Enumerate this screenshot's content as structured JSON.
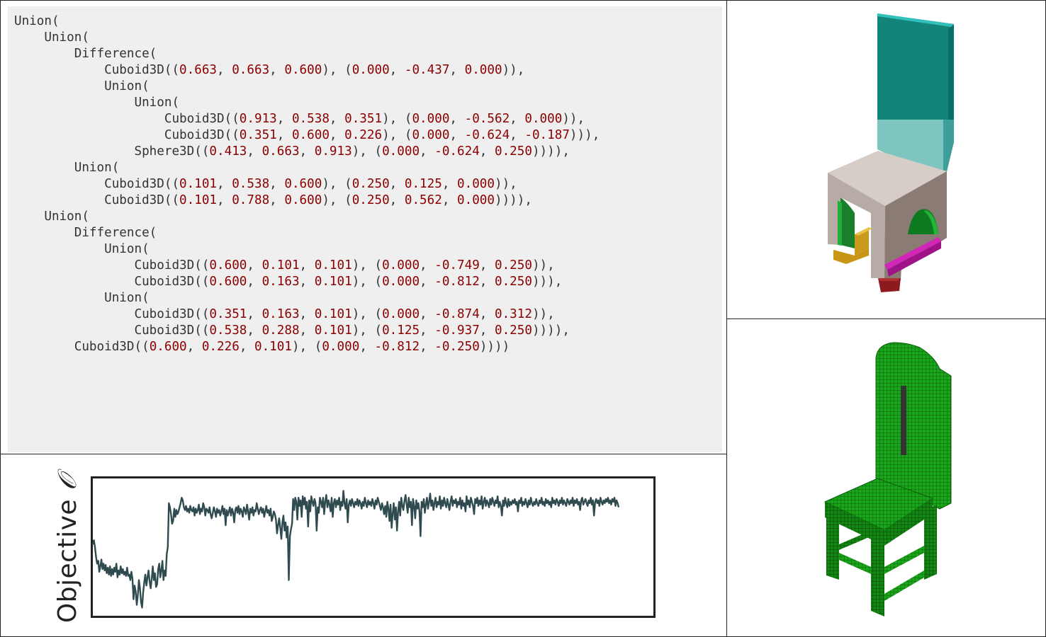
{
  "code": {
    "lines": [
      {
        "indent": 0,
        "parts": [
          {
            "t": "Union("
          }
        ]
      },
      {
        "indent": 1,
        "parts": [
          {
            "t": "Union("
          }
        ]
      },
      {
        "indent": 2,
        "parts": [
          {
            "t": "Difference("
          }
        ]
      },
      {
        "indent": 3,
        "parts": [
          {
            "t": "Cuboid3D(("
          },
          {
            "n": "0.663"
          },
          {
            "t": ", "
          },
          {
            "n": "0.663"
          },
          {
            "t": ", "
          },
          {
            "n": "0.600"
          },
          {
            "t": "), ("
          },
          {
            "n": "0.000"
          },
          {
            "t": ", "
          },
          {
            "n": "-0.437"
          },
          {
            "t": ", "
          },
          {
            "n": "0.000"
          },
          {
            "t": ")),"
          }
        ]
      },
      {
        "indent": 3,
        "parts": [
          {
            "t": "Union("
          }
        ]
      },
      {
        "indent": 4,
        "parts": [
          {
            "t": "Union("
          }
        ]
      },
      {
        "indent": 5,
        "parts": [
          {
            "t": "Cuboid3D(("
          },
          {
            "n": "0.913"
          },
          {
            "t": ", "
          },
          {
            "n": "0.538"
          },
          {
            "t": ", "
          },
          {
            "n": "0.351"
          },
          {
            "t": "), ("
          },
          {
            "n": "0.000"
          },
          {
            "t": ", "
          },
          {
            "n": "-0.562"
          },
          {
            "t": ", "
          },
          {
            "n": "0.000"
          },
          {
            "t": ")),"
          }
        ]
      },
      {
        "indent": 5,
        "parts": [
          {
            "t": "Cuboid3D(("
          },
          {
            "n": "0.351"
          },
          {
            "t": ", "
          },
          {
            "n": "0.600"
          },
          {
            "t": ", "
          },
          {
            "n": "0.226"
          },
          {
            "t": "), ("
          },
          {
            "n": "0.000"
          },
          {
            "t": ", "
          },
          {
            "n": "-0.624"
          },
          {
            "t": ", "
          },
          {
            "n": "-0.187"
          },
          {
            "t": "))),"
          }
        ]
      },
      {
        "indent": 4,
        "parts": [
          {
            "t": "Sphere3D(("
          },
          {
            "n": "0.413"
          },
          {
            "t": ", "
          },
          {
            "n": "0.663"
          },
          {
            "t": ", "
          },
          {
            "n": "0.913"
          },
          {
            "t": "), ("
          },
          {
            "n": "0.000"
          },
          {
            "t": ", "
          },
          {
            "n": "-0.624"
          },
          {
            "t": ", "
          },
          {
            "n": "0.250"
          },
          {
            "t": ")))),"
          }
        ]
      },
      {
        "indent": 2,
        "parts": [
          {
            "t": "Union("
          }
        ]
      },
      {
        "indent": 3,
        "parts": [
          {
            "t": "Cuboid3D(("
          },
          {
            "n": "0.101"
          },
          {
            "t": ", "
          },
          {
            "n": "0.538"
          },
          {
            "t": ", "
          },
          {
            "n": "0.600"
          },
          {
            "t": "), ("
          },
          {
            "n": "0.250"
          },
          {
            "t": ", "
          },
          {
            "n": "0.125"
          },
          {
            "t": ", "
          },
          {
            "n": "0.000"
          },
          {
            "t": ")),"
          }
        ]
      },
      {
        "indent": 3,
        "parts": [
          {
            "t": "Cuboid3D(("
          },
          {
            "n": "0.101"
          },
          {
            "t": ", "
          },
          {
            "n": "0.788"
          },
          {
            "t": ", "
          },
          {
            "n": "0.600"
          },
          {
            "t": "), ("
          },
          {
            "n": "0.250"
          },
          {
            "t": ", "
          },
          {
            "n": "0.562"
          },
          {
            "t": ", "
          },
          {
            "n": "0.000"
          },
          {
            "t": ")))),"
          }
        ]
      },
      {
        "indent": 1,
        "parts": [
          {
            "t": "Union("
          }
        ]
      },
      {
        "indent": 2,
        "parts": [
          {
            "t": "Difference("
          }
        ]
      },
      {
        "indent": 3,
        "parts": [
          {
            "t": "Union("
          }
        ]
      },
      {
        "indent": 4,
        "parts": [
          {
            "t": "Cuboid3D(("
          },
          {
            "n": "0.600"
          },
          {
            "t": ", "
          },
          {
            "n": "0.101"
          },
          {
            "t": ", "
          },
          {
            "n": "0.101"
          },
          {
            "t": "), ("
          },
          {
            "n": "0.000"
          },
          {
            "t": ", "
          },
          {
            "n": "-0.749"
          },
          {
            "t": ", "
          },
          {
            "n": "0.250"
          },
          {
            "t": ")),"
          }
        ]
      },
      {
        "indent": 4,
        "parts": [
          {
            "t": "Cuboid3D(("
          },
          {
            "n": "0.600"
          },
          {
            "t": ", "
          },
          {
            "n": "0.163"
          },
          {
            "t": ", "
          },
          {
            "n": "0.101"
          },
          {
            "t": "), ("
          },
          {
            "n": "0.000"
          },
          {
            "t": ", "
          },
          {
            "n": "-0.812"
          },
          {
            "t": ", "
          },
          {
            "n": "0.250"
          },
          {
            "t": "))),"
          }
        ]
      },
      {
        "indent": 3,
        "parts": [
          {
            "t": "Union("
          }
        ]
      },
      {
        "indent": 4,
        "parts": [
          {
            "t": "Cuboid3D(("
          },
          {
            "n": "0.351"
          },
          {
            "t": ", "
          },
          {
            "n": "0.163"
          },
          {
            "t": ", "
          },
          {
            "n": "0.101"
          },
          {
            "t": "), ("
          },
          {
            "n": "0.000"
          },
          {
            "t": ", "
          },
          {
            "n": "-0.874"
          },
          {
            "t": ", "
          },
          {
            "n": "0.312"
          },
          {
            "t": ")),"
          }
        ]
      },
      {
        "indent": 4,
        "parts": [
          {
            "t": "Cuboid3D(("
          },
          {
            "n": "0.538"
          },
          {
            "t": ", "
          },
          {
            "n": "0.288"
          },
          {
            "t": ", "
          },
          {
            "n": "0.101"
          },
          {
            "t": "), ("
          },
          {
            "n": "0.125"
          },
          {
            "t": ", "
          },
          {
            "n": "-0.937"
          },
          {
            "t": ", "
          },
          {
            "n": "0.250"
          },
          {
            "t": ")))),"
          }
        ]
      },
      {
        "indent": 2,
        "parts": [
          {
            "t": "Cuboid3D(("
          },
          {
            "n": "0.600"
          },
          {
            "t": ", "
          },
          {
            "n": "0.226"
          },
          {
            "t": ", "
          },
          {
            "n": "0.101"
          },
          {
            "t": "), ("
          },
          {
            "n": "0.000"
          },
          {
            "t": ", "
          },
          {
            "n": "-0.812"
          },
          {
            "t": ", "
          },
          {
            "n": "-0.250"
          },
          {
            "t": "))))"
          }
        ]
      }
    ]
  },
  "plot": {
    "ylabel": "Objective",
    "ylabel_symbol": "𝒪"
  },
  "colors": {
    "code_background": "#efefef",
    "code_text": "#333333",
    "code_number": "#8b0000",
    "plot_line": "#2f4b4f",
    "teal_back": "#18958a",
    "seat": "#d6cdc6",
    "voxel_green": "#1aa51a"
  },
  "chart_data": {
    "type": "line",
    "title": "",
    "xlabel": "",
    "ylabel": "Objective 𝒪",
    "grid": false,
    "ylim": [
      0,
      1
    ],
    "series": [
      {
        "values": [
          0.52,
          0.55,
          0.5,
          0.43,
          0.38,
          0.4,
          0.32,
          0.36,
          0.41,
          0.34,
          0.38,
          0.33,
          0.37,
          0.31,
          0.35,
          0.3,
          0.36,
          0.29,
          0.34,
          0.3,
          0.35,
          0.32,
          0.38,
          0.28,
          0.33,
          0.3,
          0.36,
          0.31,
          0.34,
          0.3,
          0.32,
          0.29,
          0.35,
          0.29,
          0.3,
          0.26,
          0.32,
          0.27,
          0.12,
          0.22,
          0.18,
          0.08,
          0.15,
          0.26,
          0.2,
          0.1,
          0.06,
          0.17,
          0.24,
          0.3,
          0.22,
          0.28,
          0.33,
          0.25,
          0.2,
          0.27,
          0.36,
          0.26,
          0.31,
          0.21,
          0.23,
          0.34,
          0.38,
          0.28,
          0.33,
          0.4,
          0.26,
          0.33,
          0.29,
          0.45,
          0.5,
          0.82,
          0.79,
          0.74,
          0.67,
          0.69,
          0.78,
          0.72,
          0.77,
          0.74,
          0.76,
          0.79,
          0.82,
          0.86,
          0.84,
          0.79,
          0.77,
          0.8,
          0.76,
          0.78,
          0.75,
          0.8,
          0.77,
          0.76,
          0.79,
          0.73,
          0.78,
          0.75,
          0.77,
          0.81,
          0.74,
          0.78,
          0.76,
          0.82,
          0.79,
          0.73,
          0.78,
          0.77,
          0.75,
          0.79,
          0.74,
          0.71,
          0.75,
          0.79,
          0.76,
          0.72,
          0.78,
          0.75,
          0.77,
          0.73,
          0.76,
          0.8,
          0.74,
          0.78,
          0.66,
          0.77,
          0.73,
          0.76,
          0.79,
          0.73,
          0.78,
          0.75,
          0.68,
          0.77,
          0.79,
          0.75,
          0.8,
          0.74,
          0.78,
          0.76,
          0.72,
          0.79,
          0.77,
          0.74,
          0.81,
          0.76,
          0.7,
          0.78,
          0.75,
          0.79,
          0.73,
          0.77,
          0.76,
          0.82,
          0.78,
          0.74,
          0.77,
          0.79,
          0.75,
          0.78,
          0.72,
          0.76,
          0.8,
          0.75,
          0.77,
          0.73,
          0.78,
          0.69,
          0.72,
          0.76,
          0.74,
          0.7,
          0.6,
          0.66,
          0.71,
          0.64,
          0.56,
          0.68,
          0.73,
          0.62,
          0.68,
          0.57,
          0.65,
          0.26,
          0.58,
          0.63,
          0.67,
          0.85,
          0.77,
          0.86,
          0.83,
          0.7,
          0.86,
          0.8,
          0.84,
          0.72,
          0.87,
          0.81,
          0.86,
          0.78,
          0.83,
          0.65,
          0.84,
          0.76,
          0.87,
          0.83,
          0.8,
          0.85,
          0.82,
          0.62,
          0.79,
          0.75,
          0.86,
          0.83,
          0.79,
          0.86,
          0.74,
          0.83,
          0.88,
          0.79,
          0.84,
          0.81,
          0.76,
          0.86,
          0.72,
          0.82,
          0.85,
          0.79,
          0.84,
          0.81,
          0.86,
          0.77,
          0.83,
          0.8,
          0.91,
          0.82,
          0.78,
          0.85,
          0.68,
          0.81,
          0.84,
          0.8,
          0.85,
          0.82,
          0.79,
          0.83,
          0.81,
          0.85,
          0.8,
          0.84,
          0.82,
          0.78,
          0.83,
          0.8,
          0.86,
          0.82,
          0.79,
          0.84,
          0.81,
          0.83,
          0.8,
          0.85,
          0.82,
          0.78,
          0.84,
          0.81,
          0.86,
          0.83,
          0.8,
          0.77,
          0.82,
          0.79,
          0.74,
          0.8,
          0.72,
          0.83,
          0.78,
          0.69,
          0.81,
          0.64,
          0.74,
          0.82,
          0.7,
          0.79,
          0.62,
          0.76,
          0.83,
          0.73,
          0.86,
          0.8,
          0.77,
          0.84,
          0.88,
          0.81,
          0.75,
          0.86,
          0.79,
          0.83,
          0.66,
          0.85,
          0.8,
          0.71,
          0.84,
          0.78,
          0.82,
          0.76,
          0.58,
          0.83,
          0.79,
          0.85,
          0.75,
          0.81,
          0.86,
          0.78,
          0.83,
          0.89,
          0.8,
          0.84,
          0.77,
          0.82,
          0.86,
          0.79,
          0.83,
          0.81,
          0.87,
          0.78,
          0.84,
          0.8,
          0.86,
          0.82,
          0.79,
          0.85,
          0.81,
          0.77,
          0.83,
          0.87,
          0.8,
          0.84,
          0.82,
          0.85,
          0.79,
          0.83,
          0.81,
          0.86,
          0.78,
          0.84,
          0.8,
          0.82,
          0.76,
          0.87,
          0.81,
          0.84,
          0.79,
          0.86,
          0.83,
          0.8,
          0.74,
          0.85,
          0.82,
          0.86,
          0.8,
          0.84,
          0.81,
          0.87,
          0.78,
          0.83,
          0.86,
          0.8,
          0.84,
          0.82,
          0.79,
          0.85,
          0.81,
          0.86,
          0.83,
          0.8,
          0.84,
          0.82,
          0.87,
          0.79,
          0.83,
          0.8,
          0.73,
          0.84,
          0.8,
          0.86,
          0.82,
          0.79,
          0.85,
          0.8,
          0.83,
          0.81,
          0.84,
          0.82,
          0.85,
          0.81,
          0.83,
          0.76,
          0.84,
          0.82,
          0.86,
          0.8,
          0.83,
          0.81,
          0.85,
          0.82,
          0.79,
          0.84,
          0.81,
          0.86,
          0.82,
          0.8,
          0.83,
          0.81,
          0.85,
          0.82,
          0.8,
          0.84,
          0.82,
          0.86,
          0.81,
          0.83,
          0.8,
          0.85,
          0.82,
          0.84,
          0.81,
          0.83,
          0.79,
          0.86,
          0.82,
          0.84,
          0.81,
          0.85,
          0.83,
          0.8,
          0.84,
          0.82,
          0.86,
          0.81,
          0.84,
          0.82,
          0.8,
          0.85,
          0.83,
          0.81,
          0.84,
          0.82,
          0.86,
          0.8,
          0.84,
          0.82,
          0.85,
          0.81,
          0.83,
          0.77,
          0.84,
          0.86,
          0.81,
          0.83,
          0.85,
          0.82,
          0.8,
          0.84,
          0.82,
          0.86,
          0.81,
          0.84,
          0.73,
          0.83,
          0.85,
          0.82,
          0.84,
          0.8,
          0.86,
          0.83,
          0.81,
          0.84,
          0.82,
          0.85,
          0.83,
          0.86,
          0.82,
          0.84,
          0.81,
          0.85,
          0.83,
          0.86,
          0.8,
          0.84,
          0.82,
          0.79
        ]
      }
    ]
  }
}
